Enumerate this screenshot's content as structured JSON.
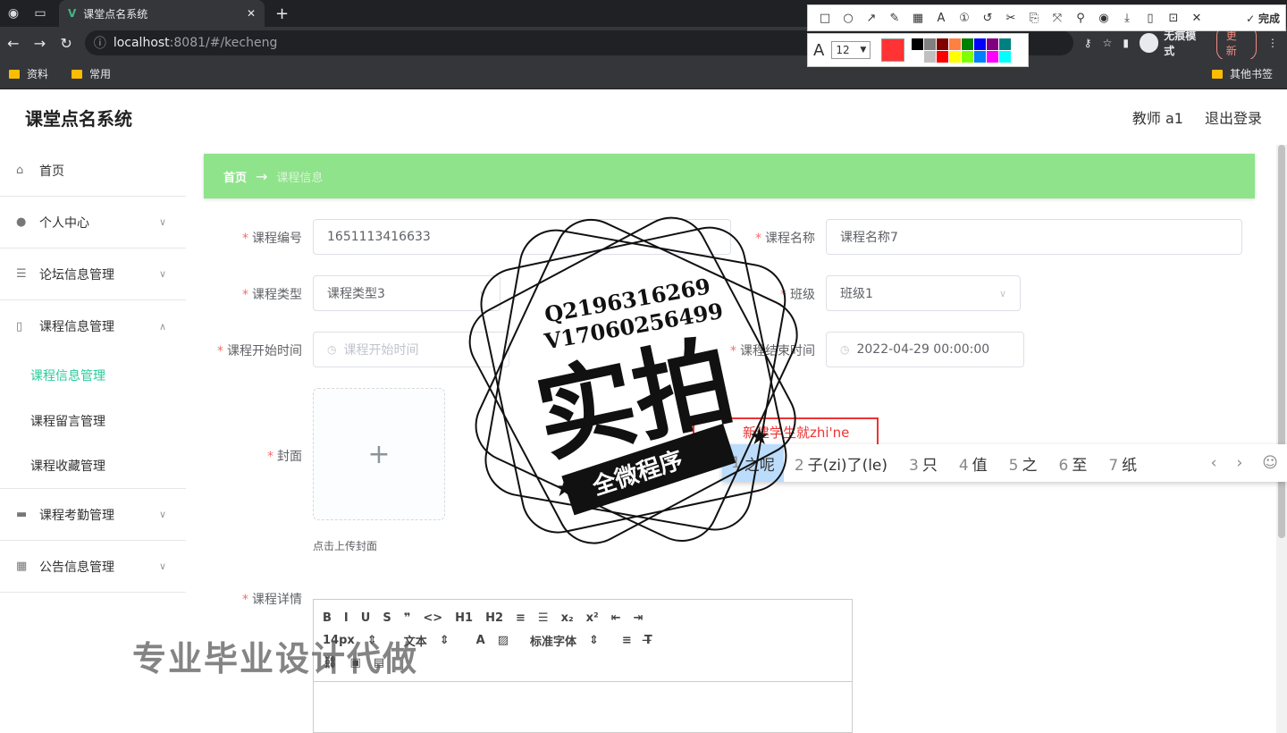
{
  "browser": {
    "tab_title": "课堂点名系统",
    "url_host": "localhost",
    "url_path": ":8081/#/kecheng",
    "incognito_label": "无痕模式",
    "update_label": "更新",
    "bookmarks": [
      "资料",
      "常用"
    ],
    "other_bookmarks": "其他书签"
  },
  "annotation_toolbar": {
    "done_label": "完成",
    "font_size": "12",
    "current_color": "#ff3333",
    "palette": [
      "#000000",
      "#808080",
      "#800000",
      "#ff8040",
      "#008000",
      "#0000ff",
      "#800080",
      "#008080",
      "#ffffff",
      "#c0c0c0",
      "#ff0000",
      "#ffff00",
      "#80ff00",
      "#0080ff",
      "#ff00ff",
      "#00ffff"
    ]
  },
  "app": {
    "title": "课堂点名系统",
    "user_label": "教师 a1",
    "logout_label": "退出登录"
  },
  "sidebar": {
    "items": [
      {
        "label": "首页",
        "icon": "home-icon"
      },
      {
        "label": "个人中心",
        "icon": "user-icon"
      },
      {
        "label": "论坛信息管理",
        "icon": "menu-icon"
      },
      {
        "label": "课程信息管理",
        "icon": "phone-icon"
      }
    ],
    "subitems": [
      "课程信息管理",
      "课程留言管理",
      "课程收藏管理"
    ],
    "items_after": [
      {
        "label": "课程考勤管理",
        "icon": "briefcase-icon"
      },
      {
        "label": "公告信息管理",
        "icon": "grid-icon"
      }
    ]
  },
  "breadcrumb": {
    "home": "首页",
    "current": "课程信息"
  },
  "form": {
    "course_no_label": "课程编号",
    "course_no_value": "1651113416633",
    "course_name_label": "课程名称",
    "course_name_value": "课程名称7",
    "course_type_label": "课程类型",
    "course_type_value": "课程类型3",
    "class_label": "班级",
    "class_value": "班级1",
    "start_time_label": "课程开始时间",
    "start_time_placeholder": "课程开始时间",
    "end_time_label": "课程结束时间",
    "end_time_value": "2022-04-29 00:00:00",
    "cover_label": "封面",
    "cover_tip": "点击上传封面",
    "detail_label": "课程详情"
  },
  "editor": {
    "row1": [
      "B",
      "I",
      "U",
      "S",
      "❞",
      "<>",
      "H1",
      "H2",
      "≡",
      "☰",
      "x₂",
      "x²",
      "⇤",
      "⇥"
    ],
    "font_size": "14px",
    "text_style": "文本",
    "font_family": "标准字体"
  },
  "ime": {
    "composing": "新建学生就zhi'ne",
    "candidates": [
      {
        "num": "1",
        "text": "之呢"
      },
      {
        "num": "2",
        "text": "子(zi)了(le)"
      },
      {
        "num": "3",
        "text": "只"
      },
      {
        "num": "4",
        "text": "值"
      },
      {
        "num": "5",
        "text": "之"
      },
      {
        "num": "6",
        "text": "至"
      },
      {
        "num": "7",
        "text": "纸"
      }
    ]
  },
  "watermark": {
    "contact_q": "Q2196316269",
    "contact_v": "V17060256499",
    "big_text": "实拍",
    "banner_text": "全微程序",
    "bottom_text": "专业毕业设计代做"
  }
}
